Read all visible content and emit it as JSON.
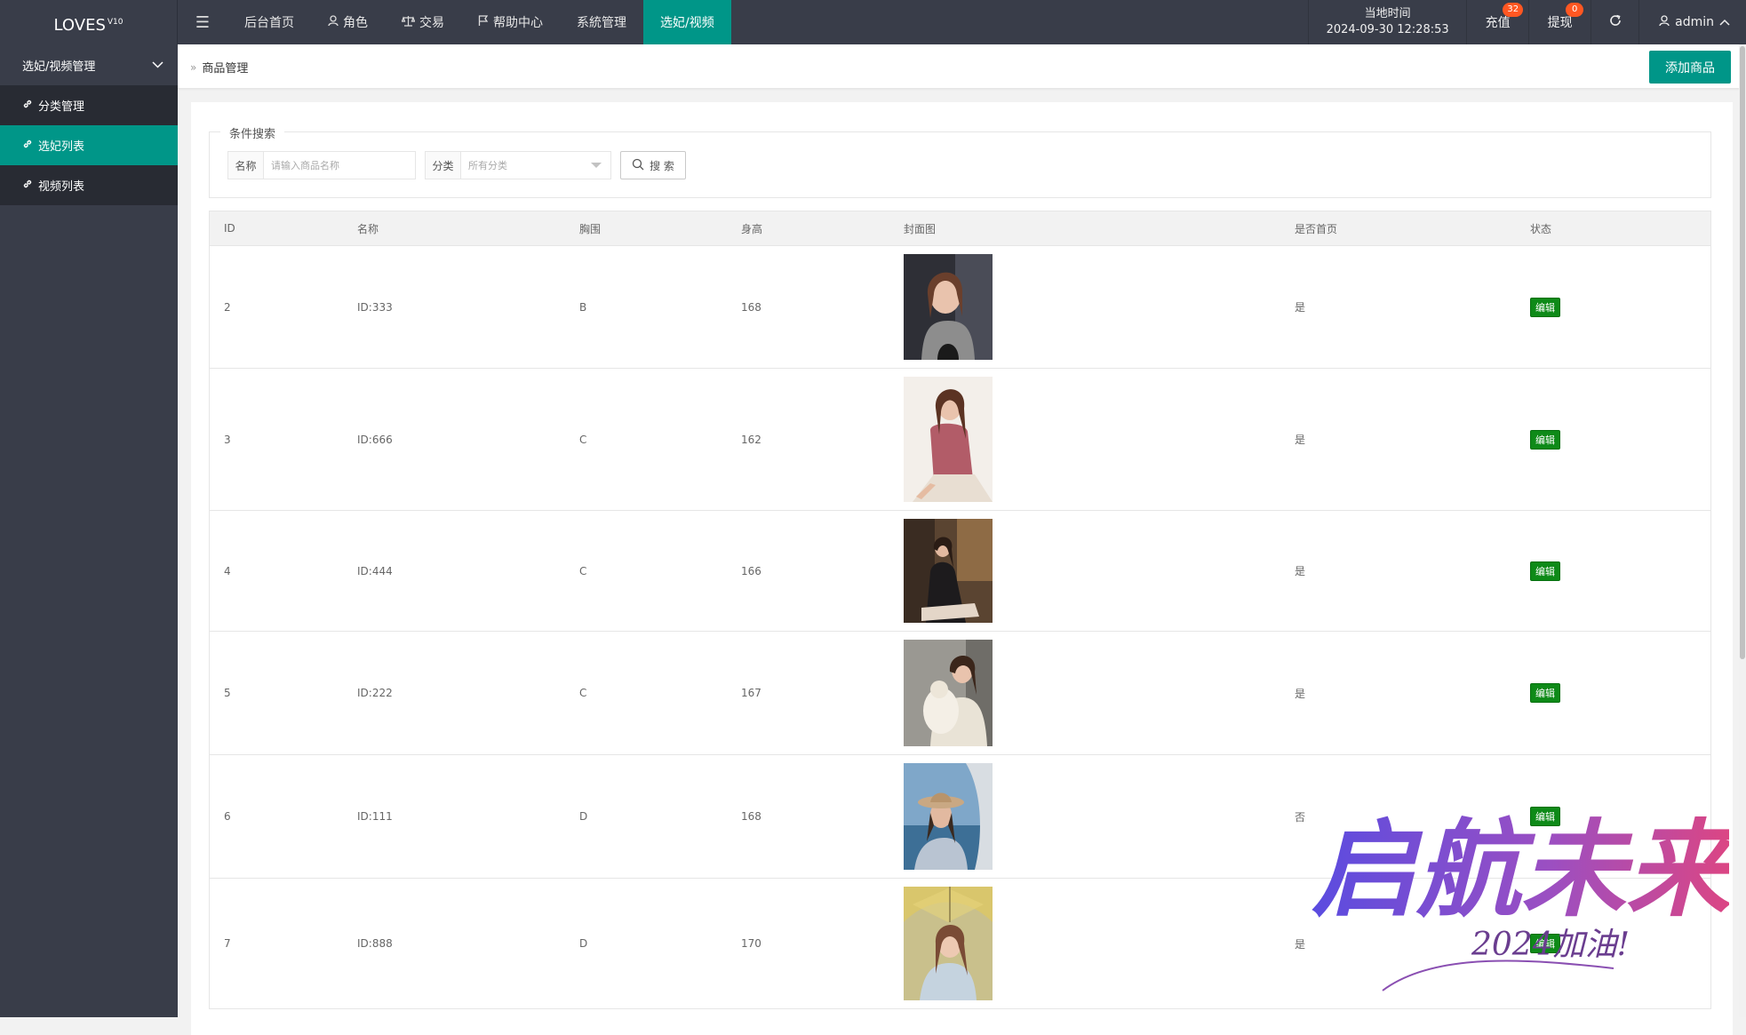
{
  "app": {
    "logo": "LOVES",
    "logo_version": "V10"
  },
  "topnav": {
    "items": [
      {
        "label": "后台首页",
        "icon": ""
      },
      {
        "label": "角色",
        "icon": "user-icon"
      },
      {
        "label": "交易",
        "icon": "scale-icon"
      },
      {
        "label": "帮助中心",
        "icon": "flag-icon"
      },
      {
        "label": "系統管理",
        "icon": ""
      },
      {
        "label": "选妃/视频",
        "icon": ""
      }
    ],
    "time_label": "当地时间",
    "time_value": "2024-09-30 12:28:53",
    "recharge_label": "充值",
    "recharge_badge": "32",
    "withdraw_label": "提现",
    "withdraw_badge": "0",
    "user_label": "admin"
  },
  "sidebar": {
    "group_label": "选妃/视频管理",
    "items": [
      {
        "label": "分类管理"
      },
      {
        "label": "选妃列表"
      },
      {
        "label": "视频列表"
      }
    ]
  },
  "breadcrumb": {
    "current": "商品管理"
  },
  "toolbar": {
    "add_label": "添加商品"
  },
  "search": {
    "legend": "条件搜索",
    "name_label": "名称",
    "name_placeholder": "请输入商品名称",
    "category_label": "分类",
    "category_value": "所有分类",
    "button_label": "搜 索"
  },
  "table": {
    "headers": [
      "ID",
      "名称",
      "胸围",
      "身高",
      "封面图",
      "是否首页",
      "状态"
    ],
    "edit_label": "编辑",
    "rows": [
      {
        "id": "2",
        "name": "ID:333",
        "bust": "B",
        "height": "168",
        "home": "是"
      },
      {
        "id": "3",
        "name": "ID:666",
        "bust": "C",
        "height": "162",
        "home": "是"
      },
      {
        "id": "4",
        "name": "ID:444",
        "bust": "C",
        "height": "166",
        "home": "是"
      },
      {
        "id": "5",
        "name": "ID:222",
        "bust": "C",
        "height": "167",
        "home": "是"
      },
      {
        "id": "6",
        "name": "ID:111",
        "bust": "D",
        "height": "168",
        "home": "否"
      },
      {
        "id": "7",
        "name": "ID:888",
        "bust": "D",
        "height": "170",
        "home": "是"
      }
    ]
  },
  "watermark": {
    "text": "启航未来",
    "subtext": "2024加油!"
  },
  "colors": {
    "accent": "#009688",
    "header_bg": "#393d49",
    "badge": "#ff5722",
    "edit": "#0e8a18"
  }
}
